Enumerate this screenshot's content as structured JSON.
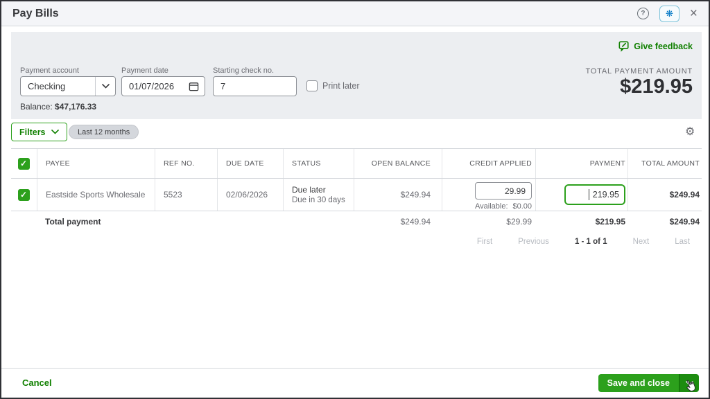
{
  "colors": {
    "accent_green": "#2ca01c",
    "link_green": "#108000",
    "dark_text": "#393a3d",
    "muted_text": "#6b6c72",
    "disabled_text": "#b6bac0",
    "panel_bg": "#eceef1",
    "border": "#d4d7dc",
    "focused_input_border": "#2ca01c",
    "sparkle_blue": "#0077c5"
  },
  "window": {
    "title": "Pay Bills"
  },
  "icons": {
    "help_glyph": "?",
    "close_glyph": "×",
    "sparkle_glyph": "❋",
    "gear_glyph": "⚙"
  },
  "panel": {
    "give_feedback_label": "Give feedback",
    "payment_account": {
      "label": "Payment account",
      "value": "Checking"
    },
    "payment_date": {
      "label": "Payment date",
      "value": "01/07/2026"
    },
    "starting_check_no": {
      "label": "Starting check no.",
      "value": "7"
    },
    "print_later_label": "Print later",
    "print_later_checked": false,
    "balance_label": "Balance:",
    "balance_value": "$47,176.33",
    "total_payment_label": "TOTAL PAYMENT AMOUNT",
    "total_payment_value": "$219.95"
  },
  "filters": {
    "button_label": "Filters",
    "date_filter_pill": "Last 12 months"
  },
  "table": {
    "columns": [
      "PAYEE",
      "REF NO.",
      "DUE DATE",
      "STATUS",
      "OPEN BALANCE",
      "CREDIT APPLIED",
      "PAYMENT",
      "TOTAL AMOUNT"
    ],
    "select_all_checked": true,
    "rows": [
      {
        "selected": true,
        "payee": "Eastside Sports Wholesale",
        "ref_no": "5523",
        "due_date": "02/06/2026",
        "status": "Due later",
        "status_sub": "Due in 30 days",
        "open_balance": "$249.94",
        "credit_applied": "29.99",
        "available_label": "Available:",
        "available_value": "$0.00",
        "payment": "219.95",
        "total_amount": "$249.94"
      }
    ],
    "totals": {
      "label": "Total payment",
      "open_balance": "$249.94",
      "credit_applied": "$29.99",
      "payment": "$219.95",
      "total_amount": "$249.94"
    }
  },
  "pagination": {
    "first": "First",
    "previous": "Previous",
    "current": "1 - 1 of 1",
    "next": "Next",
    "last": "Last"
  },
  "footer": {
    "cancel_label": "Cancel",
    "save_button_label": "Save and close"
  }
}
